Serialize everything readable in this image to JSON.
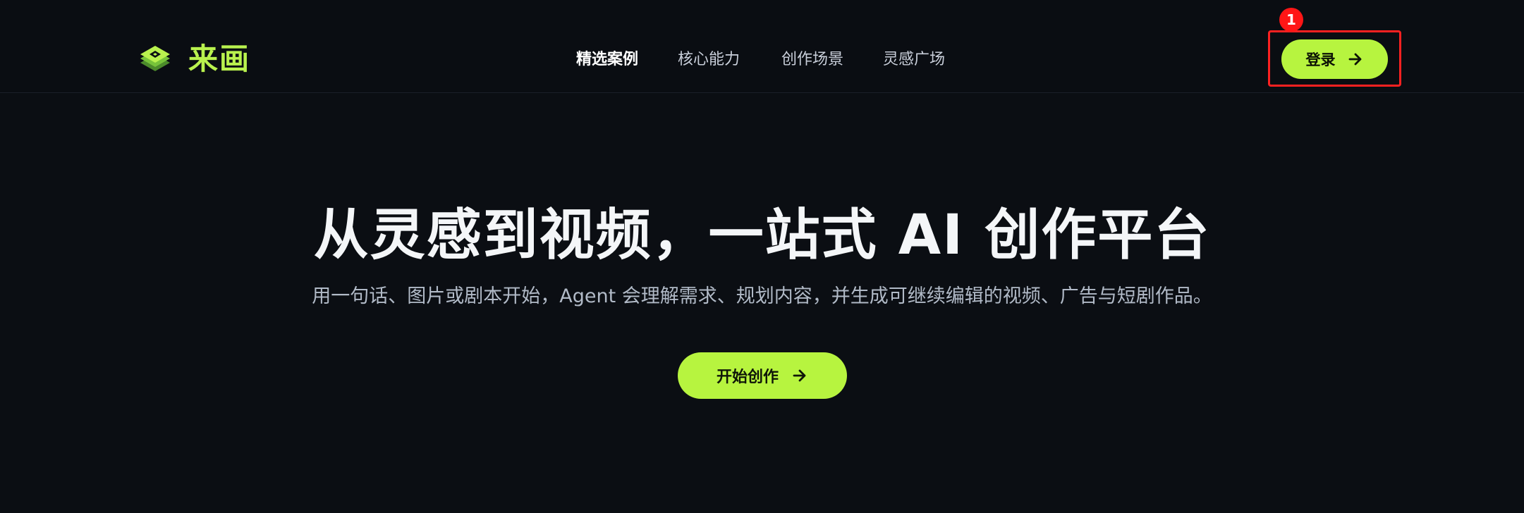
{
  "brand": {
    "name": "来画",
    "accent_color": "#b7f43f"
  },
  "nav": {
    "items": [
      {
        "label": "精选案例",
        "active": true
      },
      {
        "label": "核心能力",
        "active": false
      },
      {
        "label": "创作场景",
        "active": false
      },
      {
        "label": "灵感广场",
        "active": false
      }
    ]
  },
  "header": {
    "login_label": "登录",
    "login_icon": "arrow-right-icon"
  },
  "annotation": {
    "badge": "1",
    "color": "#ff2121"
  },
  "hero": {
    "title": "从灵感到视频，一站式 AI 创作平台",
    "subtitle": "用一句话、图片或剧本开始，Agent 会理解需求、规划内容，并生成可继续编辑的视频、广告与短剧作品。",
    "cta_label": "开始创作",
    "cta_icon": "arrow-right-icon"
  }
}
